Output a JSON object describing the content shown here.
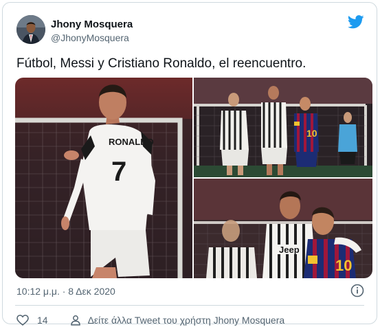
{
  "author": {
    "name": "Jhony Mosquera",
    "handle": "@JhonyMosquera"
  },
  "tweet": {
    "text": "Fútbol, Messi y Cristiano Ronaldo, el reencuentro."
  },
  "photos": {
    "main_jersey_name": "RONALDO",
    "main_jersey_number": "7",
    "messi_jersey_number": "10",
    "sponsor_text": "Jeep",
    "count": 3
  },
  "footer": {
    "timestamp": "10:12 μ.μ. · 8 Δεκ 2020",
    "like_count": "14",
    "more_tweets": "Δείτε άλλα Tweet του χρήστη Jhony Mosquera"
  },
  "colors": {
    "twitter_blue": "#1d9bf0",
    "text_primary": "#0f1419",
    "text_secondary": "#536471",
    "border": "#cfd9de"
  },
  "icons": [
    "twitter-bird-icon",
    "info-icon",
    "heart-icon",
    "person-icon"
  ]
}
